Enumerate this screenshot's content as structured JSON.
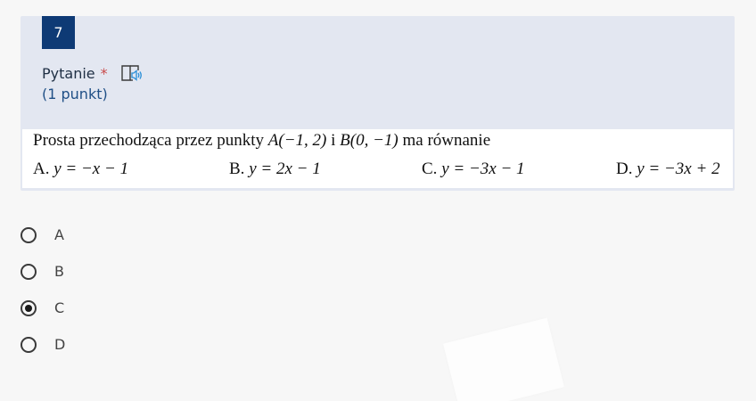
{
  "question": {
    "number": "7",
    "label": "Pytanie",
    "required_mark": "*",
    "points": "(1 punkt)",
    "text_prefix": "Prosta przechodząca przez punkty ",
    "point_a": "A(−1, 2)",
    "conj": " i ",
    "point_b": "B(0, −1)",
    "text_suffix": " ma równanie",
    "answers": [
      {
        "letter": "A.",
        "expr": "y = −x − 1"
      },
      {
        "letter": "B.",
        "expr": "y = 2x − 1"
      },
      {
        "letter": "C.",
        "expr": "y = −3x − 1"
      },
      {
        "letter": "D.",
        "expr": "y = −3x + 2"
      }
    ]
  },
  "options": [
    {
      "label": "A",
      "checked": false
    },
    {
      "label": "B",
      "checked": false
    },
    {
      "label": "C",
      "checked": true
    },
    {
      "label": "D",
      "checked": false
    }
  ],
  "icons": {
    "reader": "immersive-reader-icon"
  },
  "colors": {
    "number_bg": "#0e3a75",
    "card_bg": "#e3e7f1",
    "required": "#c94a4a",
    "points_text": "#1f4f86",
    "icon_accent": "#2a8fd8"
  }
}
